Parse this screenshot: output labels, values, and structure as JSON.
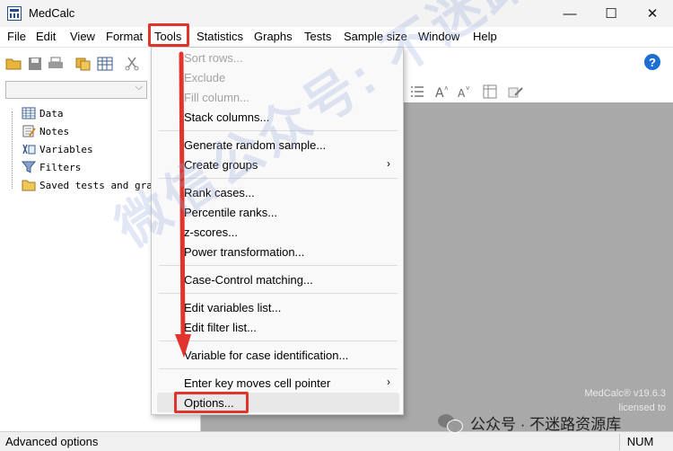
{
  "window": {
    "title": "MedCalc",
    "minimize": "—",
    "maximize": "☐",
    "close": "✕"
  },
  "menubar": {
    "items": [
      "File",
      "Edit",
      "View",
      "Format",
      "Tools",
      "Statistics",
      "Graphs",
      "Tests",
      "Sample size",
      "Window",
      "Help"
    ]
  },
  "toolbar": {
    "help": "?"
  },
  "left_pane": {
    "items": [
      {
        "label": "Data",
        "icon": "data-grid-icon"
      },
      {
        "label": "Notes",
        "icon": "notes-icon"
      },
      {
        "label": "Variables",
        "icon": "variables-icon"
      },
      {
        "label": "Filters",
        "icon": "filter-icon"
      },
      {
        "label": "Saved tests and graph",
        "icon": "folder-icon"
      }
    ]
  },
  "tools_menu": {
    "items": [
      {
        "label": "Sort rows...",
        "disabled": true
      },
      {
        "label": "Exclude",
        "disabled": true
      },
      {
        "label": "Fill column...",
        "disabled": true
      },
      {
        "label": "Stack columns...",
        "disabled": false
      },
      {
        "label": "Generate random sample...",
        "disabled": false
      },
      {
        "label": "Create groups",
        "disabled": false,
        "submenu": true
      },
      {
        "label": "Rank cases...",
        "disabled": false
      },
      {
        "label": "Percentile ranks...",
        "disabled": false
      },
      {
        "label": "z-scores...",
        "disabled": false
      },
      {
        "label": "Power transformation...",
        "disabled": false
      },
      {
        "label": "Case-Control matching...",
        "disabled": false
      },
      {
        "label": "Edit variables list...",
        "disabled": false
      },
      {
        "label": "Edit filter list...",
        "disabled": false
      },
      {
        "label": "Variable for case identification...",
        "disabled": false
      },
      {
        "label": "Enter key moves cell pointer",
        "disabled": false,
        "submenu": true
      },
      {
        "label": "Options...",
        "disabled": false
      }
    ],
    "submenu_arrow": "›"
  },
  "version_info": {
    "line1": "MedCalc® v19.6.3",
    "line2": "licensed to"
  },
  "statusbar": {
    "text": "Advanced options",
    "num": "NUM"
  },
  "overlay": {
    "watermark": "微信公众号: 不迷路资源库",
    "wechat_tag": "公众号 · 不迷路资源库"
  },
  "colors": {
    "highlight_red": "#e0342c",
    "workspace_gray": "#a9a9a9",
    "help_blue": "#1c6fd1"
  }
}
